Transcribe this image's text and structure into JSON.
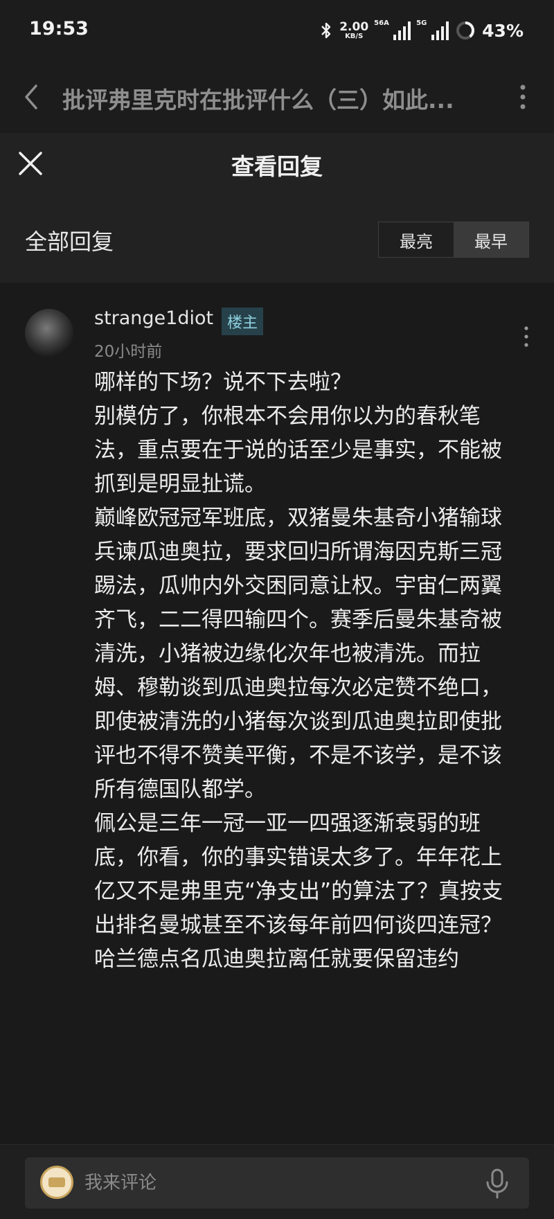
{
  "status": {
    "time": "19:53",
    "speed_value": "2.00",
    "speed_unit": "KB/S",
    "sim1": "56A",
    "sim2": "5G",
    "battery": "43%"
  },
  "nav": {
    "article_title": "批评弗里克时在批评什么（三）如此..."
  },
  "sheet": {
    "title": "查看回复"
  },
  "replies": {
    "label": "全部回复",
    "sort_options": [
      "最亮",
      "最早"
    ],
    "active_sort": "最亮"
  },
  "comment": {
    "username": "strange1diot",
    "badge": "楼主",
    "time": "20小时前",
    "paragraphs": [
      "哪样的下场？说不下去啦？",
      "别模仿了，你根本不会用你以为的春秋笔法，重点要在于说的话至少是事实，不能被抓到是明显扯谎。",
      "巅峰欧冠冠军班底，双猪曼朱基奇小猪输球兵谏瓜迪奥拉，要求回归所谓海因克斯三冠踢法，瓜帅内外交困同意让权。宇宙仁两翼齐飞，二二得四输四个。赛季后曼朱基奇被清洗，小猪被边缘化次年也被清洗。而拉姆、穆勒谈到瓜迪奥拉每次必定赞不绝口，即使被清洗的小猪每次谈到瓜迪奥拉即使批评也不得不赞美平衡，不是不该学，是不该所有德国队都学。",
      "佩公是三年一冠一亚一四强逐渐衰弱的班底，你看，你的事实错误太多了。年年花上亿又不是弗里克“净支出”的算法了？真按支出排名曼城甚至不该每年前四何谈四连冠？",
      "哈兰德点名瓜迪奥拉离任就要保留违约"
    ]
  },
  "composer": {
    "placeholder": "我来评论"
  },
  "colors": {
    "background": "#1a1a1a",
    "header": "#222222",
    "badge_bg": "#26414a",
    "badge_text": "#8fd1e0"
  }
}
